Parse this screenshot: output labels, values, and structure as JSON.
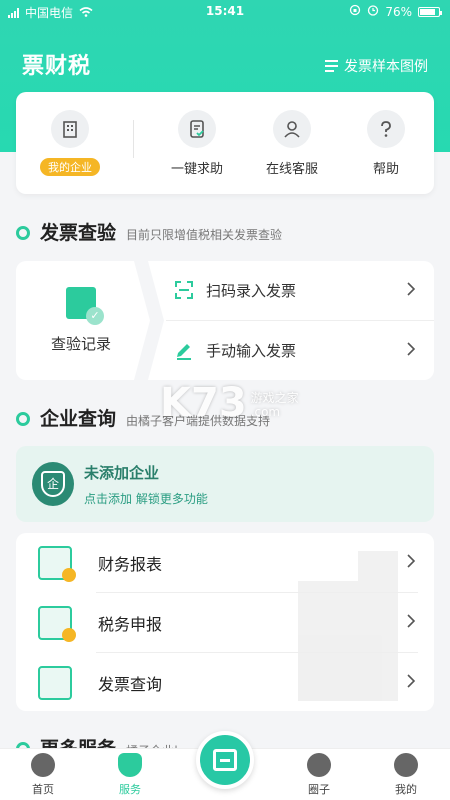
{
  "status_bar": {
    "carrier": "中国电信",
    "time": "15:41",
    "battery": "76%"
  },
  "header": {
    "title": "票财税",
    "sample_link": "发票样本图例"
  },
  "quick_actions": {
    "my_company_badge": "我的企业",
    "items": [
      {
        "label": "一键求助",
        "icon": "document-check-icon"
      },
      {
        "label": "在线客服",
        "icon": "person-icon"
      },
      {
        "label": "帮助",
        "icon": "question-icon"
      }
    ]
  },
  "invoice_section": {
    "title": "发票查验",
    "subtitle": "目前只限增值税相关发票查验",
    "record_label": "查验记录",
    "scan_label": "扫码录入发票",
    "manual_label": "手动输入发票"
  },
  "company_section": {
    "title": "企业查询",
    "subtitle": "由橘子客户端提供数据支持",
    "card_title": "未添加企业",
    "card_subtitle": "点击添加 解锁更多功能",
    "card_icon_char": "企"
  },
  "services": [
    {
      "label": "财务报表",
      "icon": "finance-report-icon"
    },
    {
      "label": "税务申报",
      "icon": "tax-declare-icon"
    },
    {
      "label": "发票查询",
      "icon": "invoice-query-icon"
    }
  ],
  "more_section": {
    "title": "更多服务",
    "subtitle": "橘子企业|"
  },
  "tabbar": {
    "items": [
      {
        "label": "首页"
      },
      {
        "label": "服务"
      },
      {
        "label": "圈子"
      },
      {
        "label": "我的"
      }
    ]
  },
  "watermark": {
    "brand": "K73",
    "site_cn": "游戏之家",
    "site_url": ".com"
  },
  "colors": {
    "accent": "#2ccb9d",
    "badge": "#f5b625",
    "company_bg": "#e6f4f0"
  }
}
